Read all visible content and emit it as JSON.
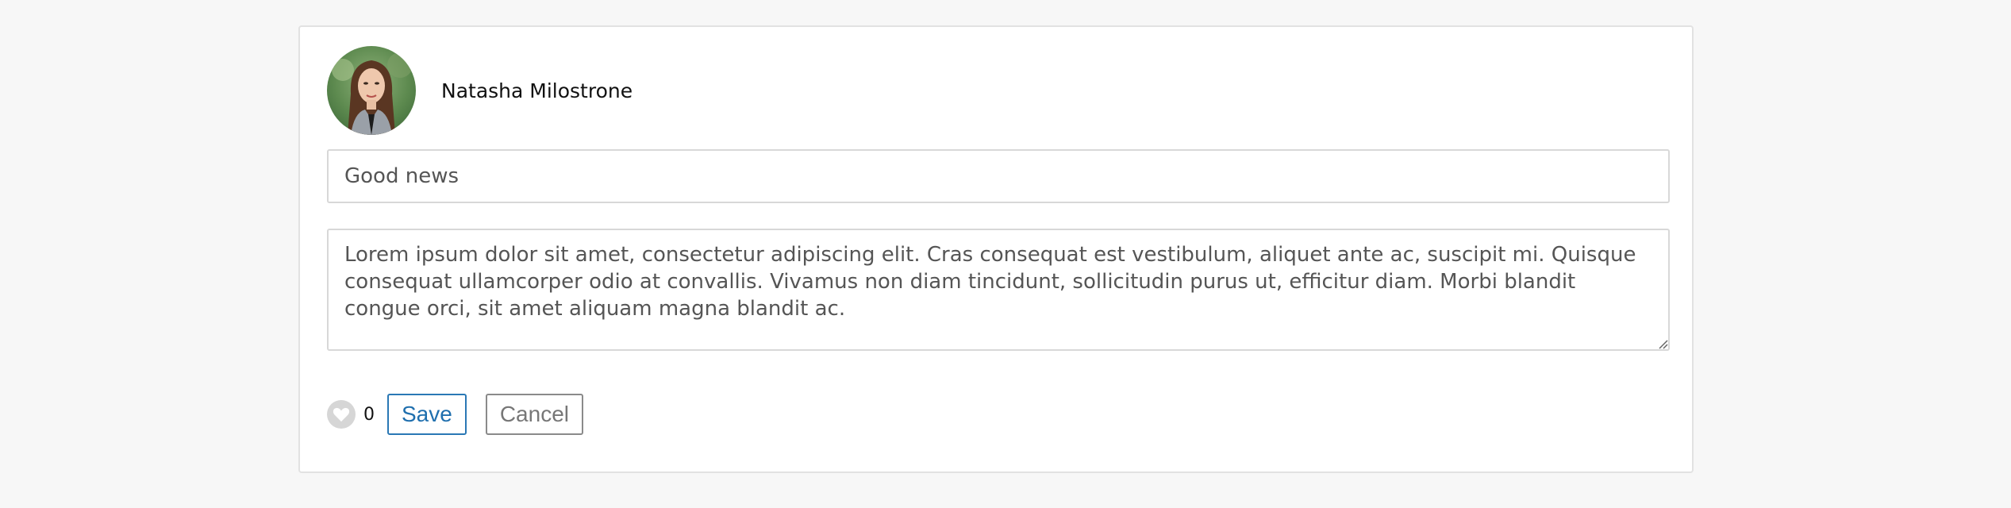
{
  "post": {
    "author_name": "Natasha Milostrone",
    "avatar_alt": "Natasha Milostrone",
    "title_value": "Good news",
    "body_value": "Lorem ipsum dolor sit amet, consectetur adipiscing elit. Cras consequat est vestibulum, aliquet ante ac, suscipit mi. Quisque consequat ullamcorper odio at convallis. Vivamus non diam tincidunt, sollicitudin purus ut, efficitur diam. Morbi blandit congue orci, sit amet aliquam magna blandit ac."
  },
  "actions": {
    "like_icon": "heart-icon",
    "like_count": "0",
    "save_label": "Save",
    "cancel_label": "Cancel"
  },
  "colors": {
    "page_background": "#f7f7f7",
    "save_accent": "#1f6fae",
    "like_background": "#d6d6d6"
  }
}
